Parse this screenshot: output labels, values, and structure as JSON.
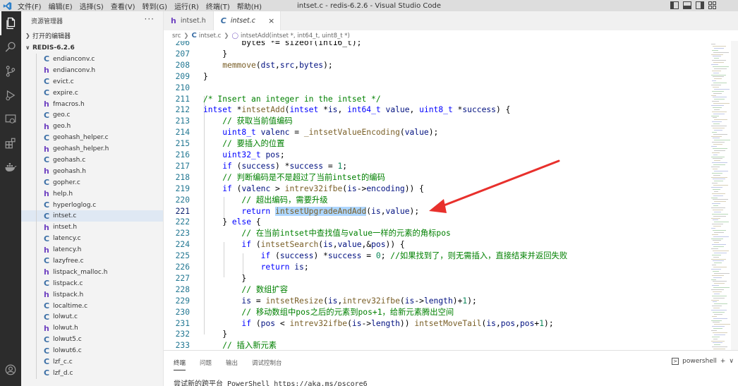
{
  "window": {
    "title": "intset.c - redis-6.2.6 - Visual Studio Code",
    "menu": [
      "文件(F)",
      "编辑(E)",
      "选择(S)",
      "查看(V)",
      "转到(G)",
      "运行(R)",
      "终端(T)",
      "帮助(H)"
    ]
  },
  "activitybar": {
    "icons": [
      "files-icon",
      "search-icon",
      "source-control-icon",
      "run-debug-icon",
      "remote-explorer-icon",
      "extensions-icon",
      "docker-icon"
    ],
    "account_icon": "account-icon"
  },
  "sidebar": {
    "title": "资源管理器",
    "more": "···",
    "open_editors": "打开的编辑器",
    "folder": "REDIS-6.2.6",
    "files": [
      {
        "name": "endianconv.c",
        "type": "C"
      },
      {
        "name": "endianconv.h",
        "type": "h"
      },
      {
        "name": "evict.c",
        "type": "C"
      },
      {
        "name": "expire.c",
        "type": "C"
      },
      {
        "name": "fmacros.h",
        "type": "h"
      },
      {
        "name": "geo.c",
        "type": "C"
      },
      {
        "name": "geo.h",
        "type": "h"
      },
      {
        "name": "geohash_helper.c",
        "type": "C"
      },
      {
        "name": "geohash_helper.h",
        "type": "h"
      },
      {
        "name": "geohash.c",
        "type": "C"
      },
      {
        "name": "geohash.h",
        "type": "h"
      },
      {
        "name": "gopher.c",
        "type": "C"
      },
      {
        "name": "help.h",
        "type": "h"
      },
      {
        "name": "hyperloglog.c",
        "type": "C"
      },
      {
        "name": "intset.c",
        "type": "C",
        "selected": true
      },
      {
        "name": "intset.h",
        "type": "h"
      },
      {
        "name": "latency.c",
        "type": "C"
      },
      {
        "name": "latency.h",
        "type": "h"
      },
      {
        "name": "lazyfree.c",
        "type": "C"
      },
      {
        "name": "listpack_malloc.h",
        "type": "h"
      },
      {
        "name": "listpack.c",
        "type": "C"
      },
      {
        "name": "listpack.h",
        "type": "h"
      },
      {
        "name": "localtime.c",
        "type": "C"
      },
      {
        "name": "lolwut.c",
        "type": "C"
      },
      {
        "name": "lolwut.h",
        "type": "h"
      },
      {
        "name": "lolwut5.c",
        "type": "C"
      },
      {
        "name": "lolwut6.c",
        "type": "C"
      },
      {
        "name": "lzf_c.c",
        "type": "C"
      },
      {
        "name": "lzf_d.c",
        "type": "C"
      }
    ]
  },
  "tabs": [
    {
      "label": "intset.h",
      "type": "h",
      "active": false
    },
    {
      "label": "intset.c",
      "type": "C",
      "active": true,
      "close": "×"
    }
  ],
  "breadcrumb": {
    "folder": "src",
    "file": "intset.c",
    "symbol": "intsetAdd(intset *, int64_t, uint8_t *)"
  },
  "editor": {
    "lines": [
      {
        "n": "206",
        "html": "        bytes *= sizeof(int16_t);"
      },
      {
        "n": "207",
        "html": "    }"
      },
      {
        "n": "208",
        "html": "    <span class=\"fn\">memmove</span>(<span class=\"var\">dst</span>,<span class=\"var\">src</span>,<span class=\"var\">bytes</span>);"
      },
      {
        "n": "209",
        "html": "}"
      },
      {
        "n": "210",
        "html": ""
      },
      {
        "n": "211",
        "html": "<span class=\"cmt\">/* Insert an integer in the intset */</span>"
      },
      {
        "n": "212",
        "html": "<span class=\"ty\">intset</span> *<span class=\"fn\">intsetAdd</span>(<span class=\"ty\">intset</span> *<span class=\"var\">is</span>, <span class=\"ty\">int64_t</span> <span class=\"var\">value</span>, <span class=\"ty\">uint8_t</span> *<span class=\"var\">success</span>) {"
      },
      {
        "n": "213",
        "html": "    <span class=\"cmt\">// 获取当前值编码</span>"
      },
      {
        "n": "214",
        "html": "    <span class=\"ty\">uint8_t</span> <span class=\"var\">valenc</span> = <span class=\"fn\">_intsetValueEncoding</span>(<span class=\"var\">value</span>);"
      },
      {
        "n": "215",
        "html": "    <span class=\"cmt\">// 要插入的位置</span>"
      },
      {
        "n": "216",
        "html": "    <span class=\"ty\">uint32_t</span> <span class=\"var\">pos</span>;"
      },
      {
        "n": "217",
        "html": "    <span class=\"kw\">if</span> (<span class=\"var\">success</span>) *<span class=\"var\">success</span> = <span class=\"num\">1</span>;"
      },
      {
        "n": "218",
        "html": "    <span class=\"cmt\">// 判断编码是不是超过了当前intset的编码</span>"
      },
      {
        "n": "219",
        "html": "    <span class=\"kw\">if</span> (<span class=\"var\">valenc</span> &gt; <span class=\"fn\">intrev32ifbe</span>(<span class=\"var\">is</span>-&gt;<span class=\"var\">encoding</span>)) {"
      },
      {
        "n": "220",
        "html": "        <span class=\"cmt\">// 超出编码，需要升级</span>"
      },
      {
        "n": "221",
        "html": "        <span class=\"kw\">return</span> <span class=\"fn hl\">intsetUpgradeAndAdd</span>(<span class=\"var\">is</span>,<span class=\"var\">value</span>);",
        "current": true
      },
      {
        "n": "222",
        "html": "    } <span class=\"kw\">else</span> {"
      },
      {
        "n": "223",
        "html": "        <span class=\"cmt\">// 在当前intset中查找值与value一样的元素的角标pos</span>"
      },
      {
        "n": "224",
        "html": "        <span class=\"kw\">if</span> (<span class=\"fn\">intsetSearch</span>(<span class=\"var\">is</span>,<span class=\"var\">value</span>,&amp;<span class=\"var\">pos</span>)) {"
      },
      {
        "n": "225",
        "html": "            <span class=\"kw\">if</span> (<span class=\"var\">success</span>) *<span class=\"var\">success</span> = <span class=\"num\">0</span>; <span class=\"cmt\">//如果找到了，则无需插入，直接结束并返回失败</span>"
      },
      {
        "n": "226",
        "html": "            <span class=\"kw\">return</span> <span class=\"var\">is</span>;"
      },
      {
        "n": "227",
        "html": "        }"
      },
      {
        "n": "228",
        "html": "        <span class=\"cmt\">// 数组扩容</span>"
      },
      {
        "n": "229",
        "html": "        <span class=\"var\">is</span> = <span class=\"fn\">intsetResize</span>(<span class=\"var\">is</span>,<span class=\"fn\">intrev32ifbe</span>(<span class=\"var\">is</span>-&gt;<span class=\"var\">length</span>)+<span class=\"num\">1</span>);"
      },
      {
        "n": "230",
        "html": "        <span class=\"cmt\">// 移动数组中pos之后的元素到pos+1，给新元素腾出空间</span>"
      },
      {
        "n": "231",
        "html": "        <span class=\"kw\">if</span> (<span class=\"var\">pos</span> &lt; <span class=\"fn\">intrev32ifbe</span>(<span class=\"var\">is</span>-&gt;<span class=\"var\">length</span>)) <span class=\"fn\">intsetMoveTail</span>(<span class=\"var\">is</span>,<span class=\"var\">pos</span>,<span class=\"var\">pos</span>+<span class=\"num\">1</span>);"
      },
      {
        "n": "232",
        "html": "    }"
      },
      {
        "n": "233",
        "html": "    <span class=\"cmt\">// 插入新元素</span>"
      }
    ]
  },
  "panel": {
    "tabs": [
      "终端",
      "问题",
      "输出",
      "调试控制台"
    ],
    "active_tab": "终端",
    "terminal_name": "powershell",
    "add": "+",
    "terminal_text": "尝试新的跨平台 PowerShell https://aka.ms/pscore6"
  },
  "colors": {
    "activitybar": "#2c2c2c",
    "accent_c": "#3a6ea5",
    "accent_h": "#6f42c1",
    "annotation_arrow": "#e8302c",
    "selection": "#add6ff"
  }
}
